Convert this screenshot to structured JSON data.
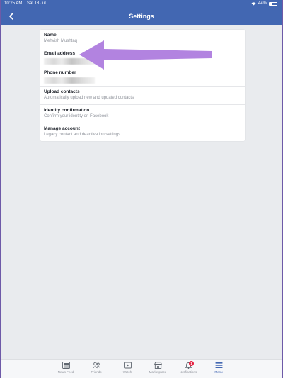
{
  "status_bar": {
    "time": "10:25 AM",
    "date": "Sat 18 Jul",
    "battery": "44%",
    "battery_level": 0.44
  },
  "header": {
    "title": "Settings",
    "back_icon": "chevron-left-icon"
  },
  "settings": [
    {
      "title": "Name",
      "subtitle": "Mehvish Mushtaq"
    },
    {
      "title": "Email address",
      "subtitle": ""
    },
    {
      "title": "Phone number",
      "subtitle": ""
    },
    {
      "title": "Upload contacts",
      "subtitle": "Automatically upload new and updated contacts"
    },
    {
      "title": "Identity confirmation",
      "subtitle": "Confirm your identity on Facebook"
    },
    {
      "title": "Manage account",
      "subtitle": "Legacy contact and deactivation settings"
    }
  ],
  "annotation": {
    "color": "#b283e0",
    "points_to": "Email address"
  },
  "tabbar": {
    "items": [
      {
        "label": "News Feed",
        "icon": "news-feed-icon"
      },
      {
        "label": "Friends",
        "icon": "friends-icon"
      },
      {
        "label": "Watch",
        "icon": "watch-icon"
      },
      {
        "label": "Marketplace",
        "icon": "marketplace-icon"
      },
      {
        "label": "Notifications",
        "icon": "bell-icon",
        "badge": "1"
      },
      {
        "label": "Menu",
        "icon": "menu-icon",
        "active": true
      }
    ]
  },
  "colors": {
    "brand": "#4267b2",
    "background": "#e9ebee",
    "badge": "#e41e3f"
  }
}
